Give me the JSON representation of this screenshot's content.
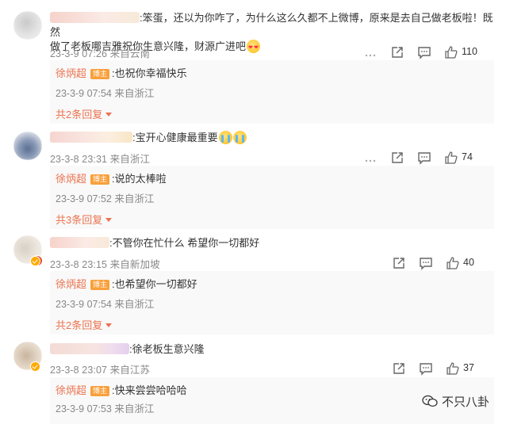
{
  "comments": [
    {
      "text": ":笨蛋，还以为你咋了，为什么这么久都不上微博，原来是去自己做老板啦！既然",
      "text_line2": "做了老板哪吉雅祝你生意兴隆，财源广进吧",
      "emoji": "heart-eyes-emoji",
      "time": "23-3-9 07:26",
      "location": "来自云南",
      "likes": "110",
      "reply": {
        "author": "徐炳超",
        "badge": "博主",
        "text": ":也祝你幸福快乐",
        "time": "23-3-9 07:54",
        "location": "来自浙江",
        "more": "共2条回复"
      }
    },
    {
      "text": ":宝开心健康最重要",
      "emoji": "crying-emoji",
      "time": "23-3-8 23:31",
      "location": "来自浙江",
      "likes": "74",
      "reply": {
        "author": "徐炳超",
        "badge": "博主",
        "text": ":说的太棒啦",
        "time": "23-3-9 07:52",
        "location": "来自浙江",
        "more": "共3条回复"
      }
    },
    {
      "text": ":不管你在忙什么 希望你一切都好",
      "time": "23-3-8 23:15",
      "location": "来自新加坡",
      "likes": "40",
      "reply": {
        "author": "徐炳超",
        "badge": "博主",
        "text": ":也希望你一切都好",
        "time": "23-3-9 07:54",
        "location": "来自浙江",
        "more": "共2条回复"
      }
    },
    {
      "text": ":徐老板生意兴隆",
      "time": "23-3-8 23:07",
      "location": "来自江苏",
      "likes": "37",
      "reply": {
        "author": "徐炳超",
        "badge": "博主",
        "text": ":快来尝尝哈哈哈",
        "time": "23-3-9 07:53",
        "location": "来自浙江"
      }
    }
  ],
  "watermark": "不只八卦",
  "colors": {
    "accent": "#eb7350",
    "blogger_badge": "#f9a03c",
    "meta": "#888888",
    "reply_bg": "#f9f9f9"
  }
}
